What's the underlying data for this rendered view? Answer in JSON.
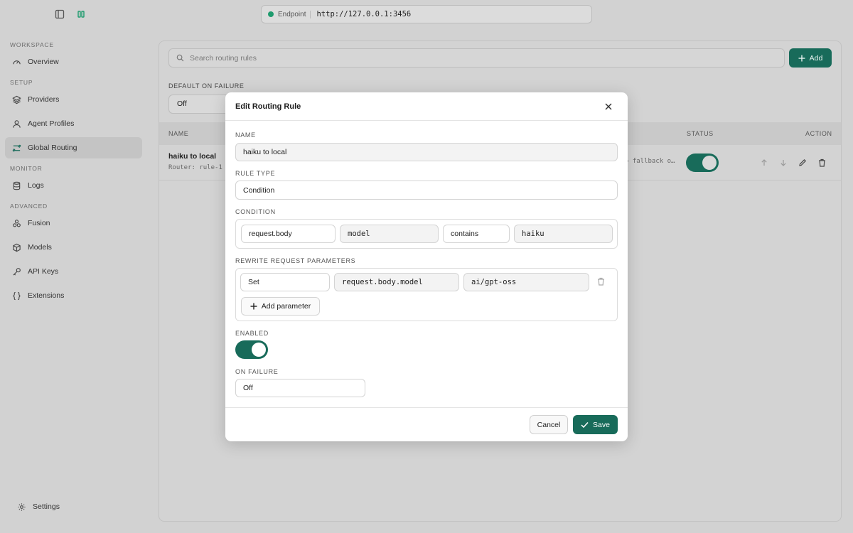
{
  "topbar": {
    "icons": [
      "sidebar-toggle-icon",
      "panel-icon"
    ],
    "endpoint_label": "Endpoint",
    "endpoint_url": "http://127.0.0.1:3456",
    "status_color": "#1f9b6e"
  },
  "sidebar": {
    "sections": [
      {
        "title": "WORKSPACE",
        "items": [
          {
            "label": "Overview",
            "icon": "gauge-icon"
          }
        ]
      },
      {
        "title": "SETUP",
        "items": [
          {
            "label": "Providers",
            "icon": "layers-icon"
          },
          {
            "label": "Agent Profiles",
            "icon": "user-icon"
          },
          {
            "label": "Global Routing",
            "icon": "routing-icon",
            "active": true
          }
        ]
      },
      {
        "title": "MONITOR",
        "items": [
          {
            "label": "Logs",
            "icon": "database-icon"
          }
        ]
      },
      {
        "title": "ADVANCED",
        "items": [
          {
            "label": "Fusion",
            "icon": "fusion-icon"
          },
          {
            "label": "Models",
            "icon": "cube-icon"
          },
          {
            "label": "API Keys",
            "icon": "key-icon"
          },
          {
            "label": "Extensions",
            "icon": "braces-icon"
          }
        ]
      }
    ],
    "settings_label": "Settings"
  },
  "main": {
    "search_placeholder": "Search routing rules",
    "add_label": "Add",
    "default_on_failure_label": "DEFAULT ON FAILURE",
    "default_on_failure_value": "Off",
    "columns": {
      "name": "NAME",
      "status": "STATUS",
      "action": "ACTION"
    },
    "rows": [
      {
        "name": "haiku to local",
        "sub": "Router: rule-1",
        "rule": "→ fallback o…",
        "enabled": true
      }
    ],
    "accent": "#186b5a"
  },
  "modal": {
    "title": "Edit Routing Rule",
    "name_label": "NAME",
    "name_value": "haiku to local",
    "rule_type_label": "RULE TYPE",
    "rule_type_value": "Condition",
    "condition_label": "CONDITION",
    "condition": {
      "source": "request.body",
      "field": "model",
      "operator": "contains",
      "value": "haiku"
    },
    "rewrite_label": "REWRITE REQUEST PARAMETERS",
    "rewrite": {
      "action": "Set",
      "path": "request.body.model",
      "value": "ai/gpt-oss"
    },
    "add_parameter_label": "Add parameter",
    "enabled_label": "ENABLED",
    "enabled": true,
    "on_failure_label": "ON FAILURE",
    "on_failure_value": "Off",
    "cancel_label": "Cancel",
    "save_label": "Save"
  }
}
